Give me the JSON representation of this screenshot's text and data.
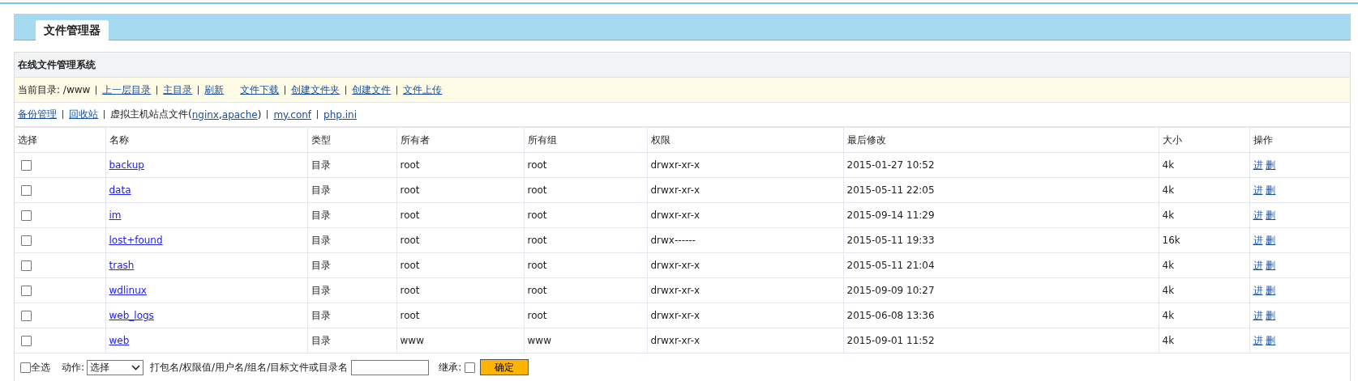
{
  "tabs": [
    {
      "label": "文件管理器",
      "selected": true
    }
  ],
  "panel": {
    "title": "在线文件管理系统",
    "path_bar": [
      {
        "kind": "text",
        "text": "当前目录: /www"
      },
      {
        "kind": "divider"
      },
      {
        "kind": "link",
        "text": "上一层目录"
      },
      {
        "kind": "divider"
      },
      {
        "kind": "link",
        "text": "主目录"
      },
      {
        "kind": "divider"
      },
      {
        "kind": "link",
        "text": "刷新"
      },
      {
        "kind": "gap"
      },
      {
        "kind": "link",
        "text": "文件下载"
      },
      {
        "kind": "divider"
      },
      {
        "kind": "link",
        "text": "创建文件夹"
      },
      {
        "kind": "divider"
      },
      {
        "kind": "link",
        "text": "创建文件"
      },
      {
        "kind": "divider"
      },
      {
        "kind": "link",
        "text": "文件上传"
      }
    ],
    "links_bar": [
      {
        "kind": "link",
        "text": "备份管理"
      },
      {
        "kind": "divider"
      },
      {
        "kind": "link",
        "text": "回收站"
      },
      {
        "kind": "divider"
      },
      {
        "kind": "text",
        "text": "虚拟主机站点文件("
      },
      {
        "kind": "link",
        "text": "nginx"
      },
      {
        "kind": "text",
        "text": ","
      },
      {
        "kind": "link",
        "text": "apache"
      },
      {
        "kind": "text",
        "text": ")"
      },
      {
        "kind": "divider"
      },
      {
        "kind": "link",
        "text": "my.conf"
      },
      {
        "kind": "divider"
      },
      {
        "kind": "link",
        "text": "php.ini"
      }
    ]
  },
  "table": {
    "columns": [
      "选择",
      "名称",
      "类型",
      "所有者",
      "所有组",
      "权限",
      "最后修改",
      "大小",
      "操作"
    ],
    "rows": [
      {
        "checked": false,
        "name": "backup",
        "type": "目录",
        "owner": "root",
        "group": "root",
        "permissions": "drwxr-xr-x",
        "modified": "2015-01-27 10:52",
        "size": "4k",
        "actions": [
          "进",
          "删"
        ]
      },
      {
        "checked": false,
        "name": "data",
        "type": "目录",
        "owner": "root",
        "group": "root",
        "permissions": "drwxr-xr-x",
        "modified": "2015-05-11 22:05",
        "size": "4k",
        "actions": [
          "进",
          "删"
        ]
      },
      {
        "checked": false,
        "name": "im",
        "type": "目录",
        "owner": "root",
        "group": "root",
        "permissions": "drwxr-xr-x",
        "modified": "2015-09-14 11:29",
        "size": "4k",
        "actions": [
          "进",
          "删"
        ]
      },
      {
        "checked": false,
        "name": "lost+found",
        "type": "目录",
        "owner": "root",
        "group": "root",
        "permissions": "drwx------",
        "modified": "2015-05-11 19:33",
        "size": "16k",
        "actions": [
          "进",
          "删"
        ]
      },
      {
        "checked": false,
        "name": "trash",
        "type": "目录",
        "owner": "root",
        "group": "root",
        "permissions": "drwxr-xr-x",
        "modified": "2015-05-11 21:04",
        "size": "4k",
        "actions": [
          "进",
          "删"
        ]
      },
      {
        "checked": false,
        "name": "wdlinux",
        "type": "目录",
        "owner": "root",
        "group": "root",
        "permissions": "drwxr-xr-x",
        "modified": "2015-09-09 10:27",
        "size": "4k",
        "actions": [
          "进",
          "删"
        ]
      },
      {
        "checked": false,
        "name": "web_logs",
        "type": "目录",
        "owner": "root",
        "group": "root",
        "permissions": "drwxr-xr-x",
        "modified": "2015-06-08 13:36",
        "size": "4k",
        "actions": [
          "进",
          "删"
        ]
      },
      {
        "checked": false,
        "name": "web",
        "type": "目录",
        "owner": "www",
        "group": "www",
        "permissions": "drwxr-xr-x",
        "modified": "2015-09-01 11:52",
        "size": "4k",
        "actions": [
          "进",
          "删"
        ]
      }
    ]
  },
  "footer": {
    "select_all": {
      "label": "全选",
      "checked": false
    },
    "action_label": "动作:",
    "action_select": {
      "value": "选择"
    },
    "target_label": "打包名/权限值/用户名/组名/目标文件或目录名",
    "inherit": {
      "label": "继承:",
      "checked": false
    },
    "confirm_button": "确定"
  }
}
